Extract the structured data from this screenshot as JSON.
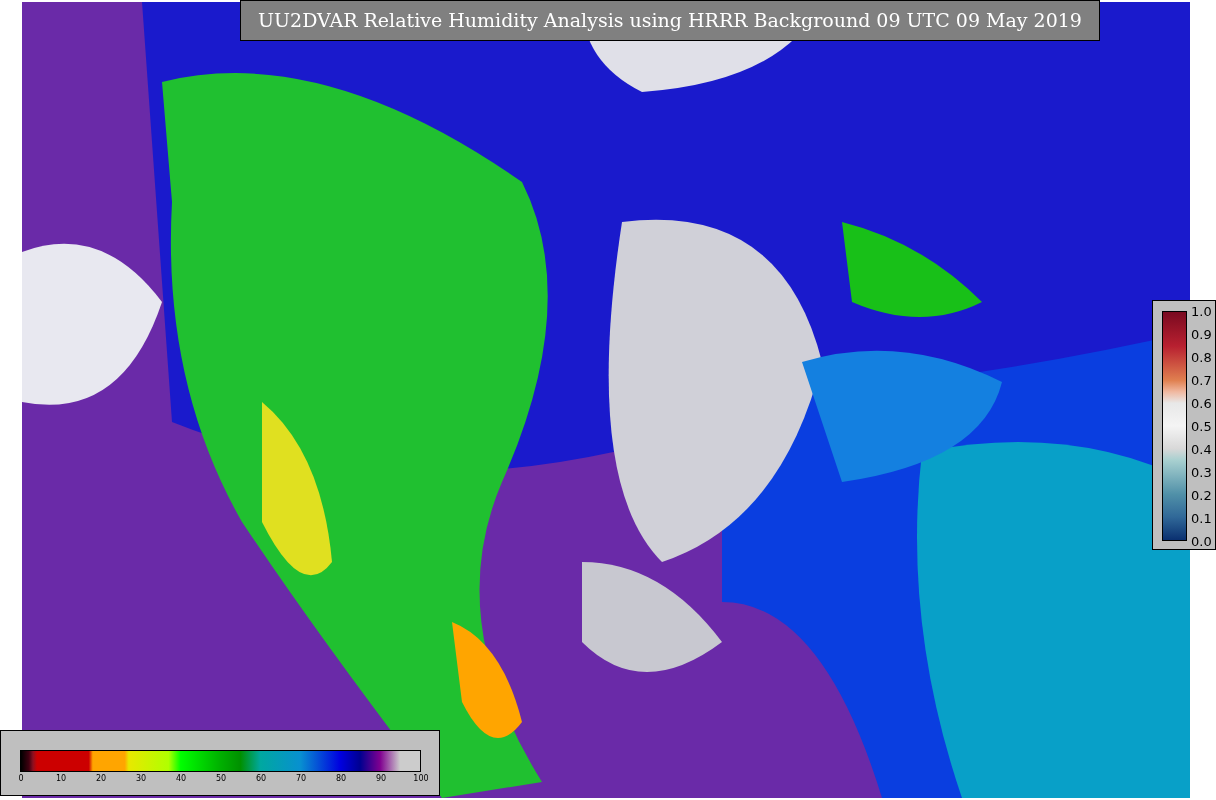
{
  "title": "UU2DVAR Relative Humidity Analysis using HRRR Background 09 UTC 09 May 2019",
  "humidity_colorbar": {
    "ticks": [
      "0",
      "10",
      "20",
      "30",
      "40",
      "50",
      "60",
      "70",
      "80",
      "90",
      "100"
    ]
  },
  "ratio_colorbar": {
    "ticks": [
      "1.0",
      "0.9",
      "0.8",
      "0.7",
      "0.6",
      "0.5",
      "0.4",
      "0.3",
      "0.2",
      "0.1",
      "0.0"
    ]
  }
}
